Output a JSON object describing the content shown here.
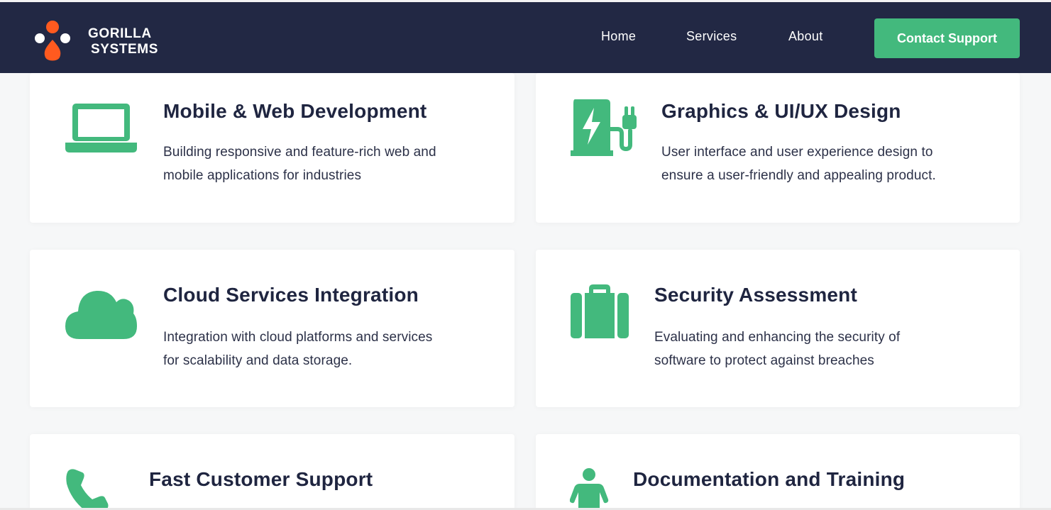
{
  "brand": {
    "line1": "GORILLA",
    "line2": "SYSTEMS",
    "colors": {
      "orange": "#ff5a1f",
      "navy": "#222844",
      "white": "#ffffff"
    }
  },
  "nav": {
    "home": "Home",
    "services": "Services",
    "about": "About",
    "contact": "Contact Support"
  },
  "theme": {
    "accent": "#43b97d",
    "header_bg": "#222844",
    "page_bg": "#f6f7f8",
    "card_bg": "#ffffff",
    "text_dark": "#1f2540"
  },
  "services": [
    {
      "icon": "laptop-icon",
      "title": "Mobile & Web Development",
      "line1": "Building responsive and feature-rich web and",
      "line2": "mobile applications for industries"
    },
    {
      "icon": "charging-station-icon",
      "title": "Graphics & UI/UX Design",
      "line1": "User interface and user experience design to",
      "line2": "ensure a user-friendly and appealing product."
    },
    {
      "icon": "cloud-icon",
      "title": "Cloud Services Integration",
      "line1": "Integration with cloud platforms and services",
      "line2": "for scalability and data storage."
    },
    {
      "icon": "suitcase-icon",
      "title": "Security Assessment",
      "line1": "Evaluating and enhancing the security of",
      "line2": "software to protect against breaches"
    },
    {
      "icon": "phone-icon",
      "title": "Fast Customer Support",
      "line1": "",
      "line2": ""
    },
    {
      "icon": "person-icon",
      "title": "Documentation and Training",
      "line1": "",
      "line2": ""
    }
  ]
}
